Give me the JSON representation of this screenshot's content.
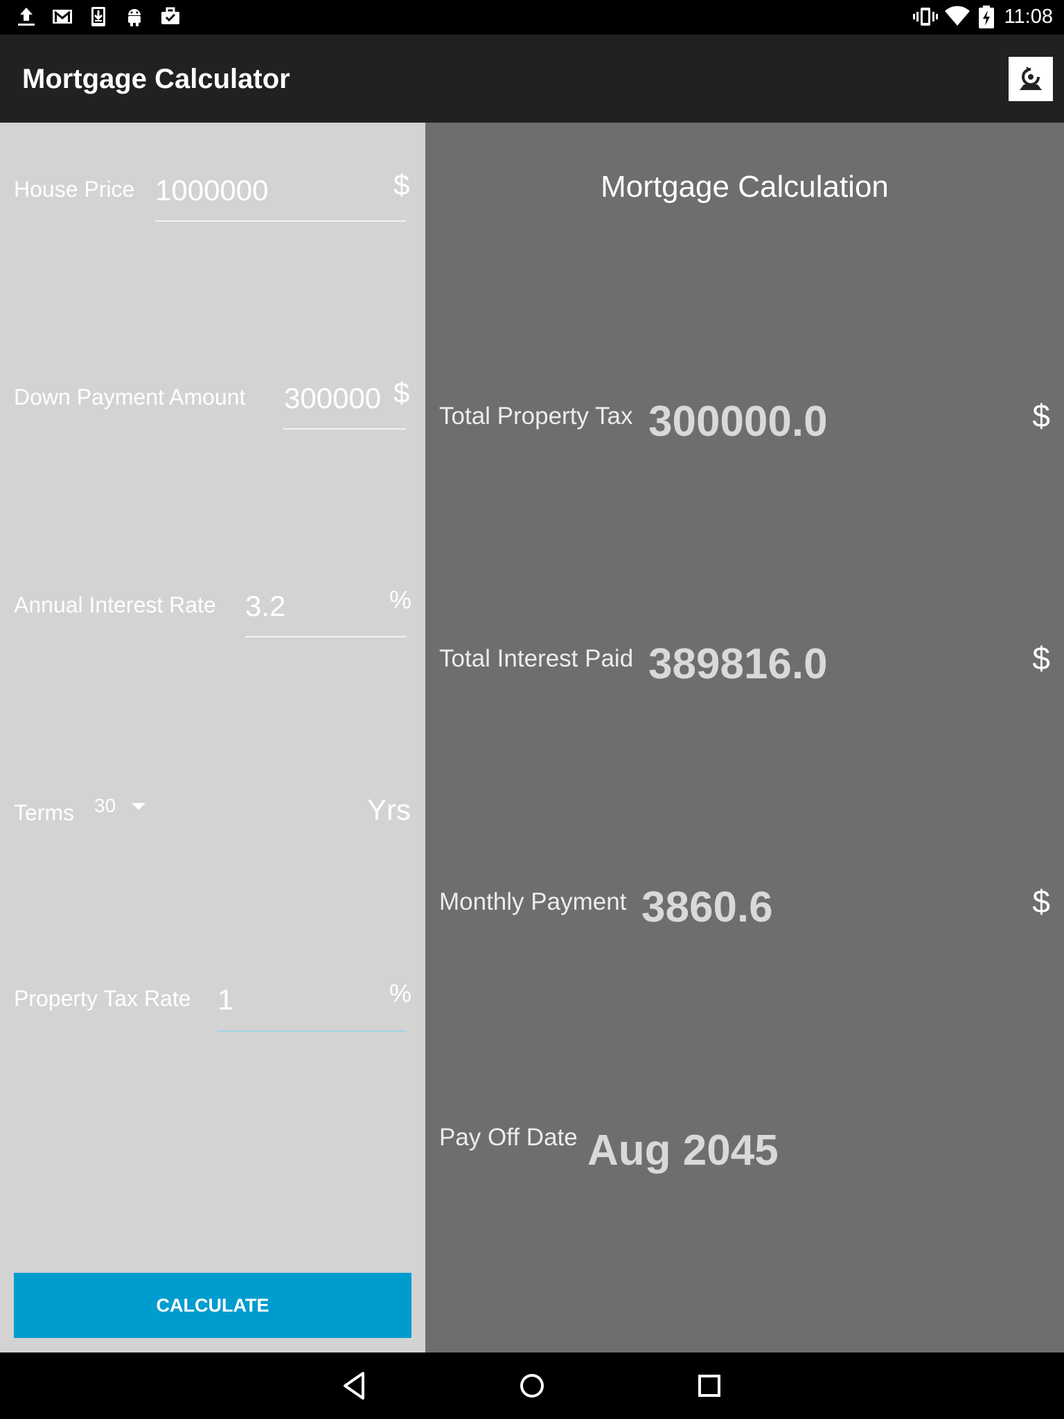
{
  "status_bar": {
    "time": "11:08",
    "left_icons": [
      "upload-icon",
      "gmail-icon",
      "download-icon",
      "android-icon",
      "briefcase-icon"
    ],
    "right_icons": [
      "vibrate-icon",
      "wifi-icon",
      "battery-charging-icon"
    ]
  },
  "app_bar": {
    "title": "Mortgage Calculator",
    "action_icon": "reset-icon"
  },
  "inputs": {
    "house_price": {
      "label": "House Price",
      "value": "1000000",
      "unit": "$"
    },
    "down_payment": {
      "label": "Down Payment Amount",
      "value": "300000",
      "unit": "$"
    },
    "interest_rate": {
      "label": "Annual Interest Rate",
      "value": "3.2",
      "unit": "%"
    },
    "terms": {
      "label": "Terms",
      "value": "30",
      "unit": "Yrs"
    },
    "property_tax_rate": {
      "label": "Property Tax Rate",
      "value": "1",
      "unit": "%"
    }
  },
  "calculate_label": "CALCULATE",
  "results": {
    "title": "Mortgage Calculation",
    "total_property_tax": {
      "label": "Total Property Tax",
      "value": "300000.0",
      "unit": "$"
    },
    "total_interest_paid": {
      "label": "Total Interest Paid",
      "value": "389816.0",
      "unit": "$"
    },
    "monthly_payment": {
      "label": "Monthly Payment",
      "value": "3860.6",
      "unit": "$"
    },
    "pay_off_date": {
      "label": "Pay Off Date",
      "value": "Aug 2045"
    }
  },
  "colors": {
    "app_bar": "#212121",
    "input_panel": "#d3d3d3",
    "result_panel": "#6e6e6e",
    "accent": "#009ccf",
    "focused_underline": "#9fd6e2"
  },
  "nav_bar": [
    "back-icon",
    "home-icon",
    "recents-icon"
  ]
}
